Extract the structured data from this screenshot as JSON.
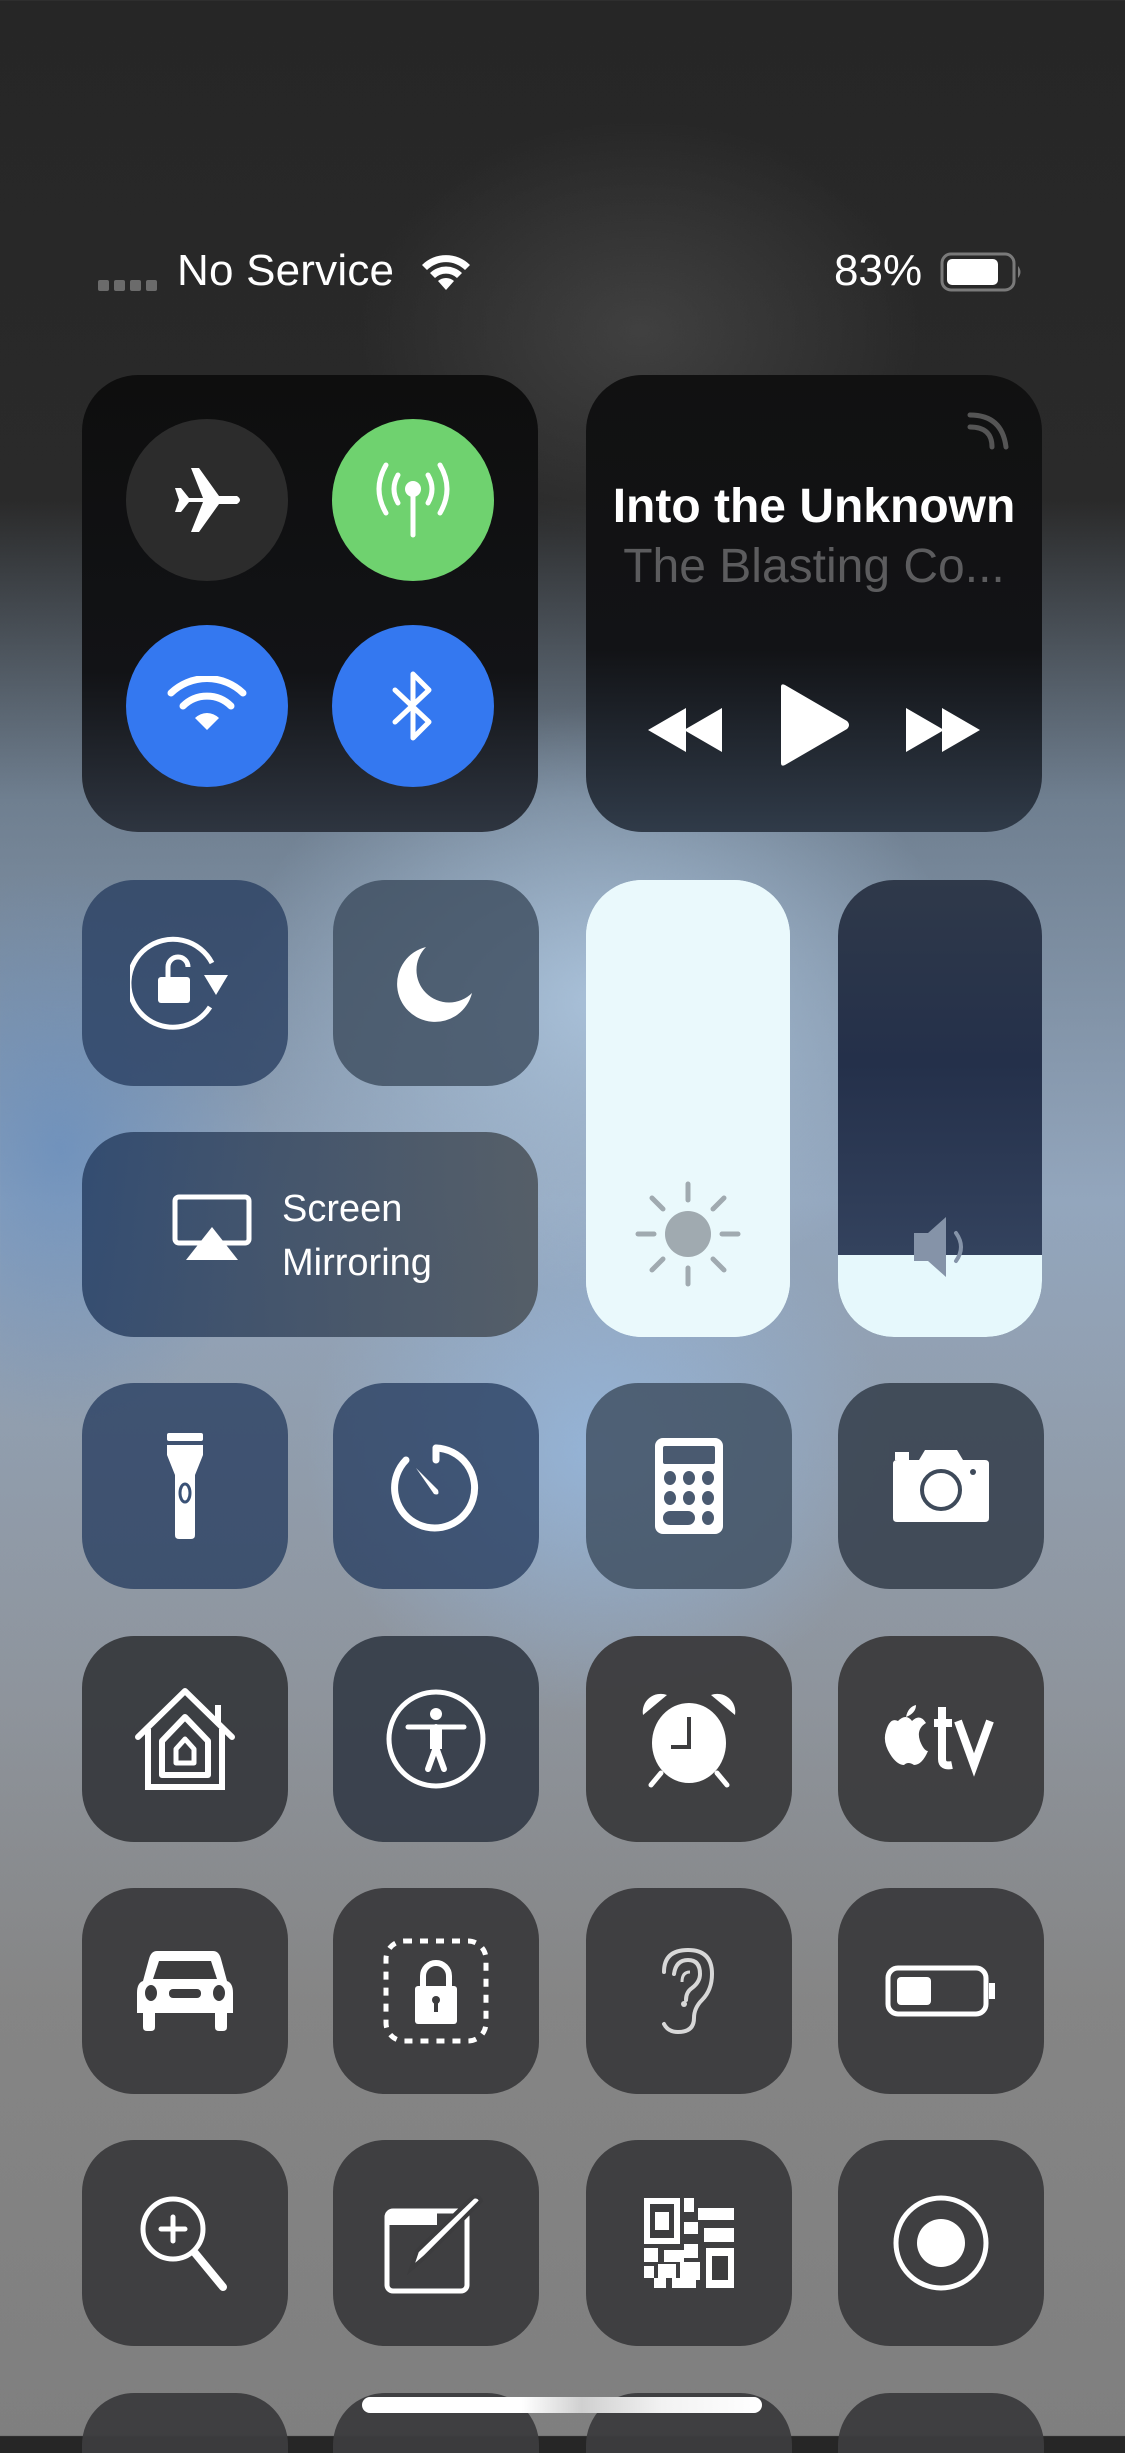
{
  "status_bar": {
    "carrier": "No Service",
    "battery_percent": "83%",
    "battery_level": 0.83,
    "signal_bars": 0,
    "wifi_connected": true
  },
  "connectivity": {
    "airplane_mode": {
      "label": "Airplane Mode",
      "on": false,
      "icon": "airplane-icon"
    },
    "cellular_data": {
      "label": "Cellular Data",
      "on": true,
      "icon": "antenna-icon",
      "color": "#6fd26f"
    },
    "wifi": {
      "label": "Wi-Fi",
      "on": true,
      "icon": "wifi-icon",
      "color": "#3478f0"
    },
    "bluetooth": {
      "label": "Bluetooth",
      "on": true,
      "icon": "bluetooth-icon",
      "color": "#3478f0"
    }
  },
  "now_playing": {
    "title": "Into the Unknown",
    "artist": "The Blasting Co...",
    "controls": [
      "rewind",
      "play",
      "fast-forward"
    ],
    "airplay_icon": "airplay-audio-icon"
  },
  "toggles": {
    "orientation_lock": {
      "label": "Orientation Lock",
      "icon": "rotation-lock-icon"
    },
    "do_not_disturb": {
      "label": "Do Not Disturb",
      "icon": "moon-icon"
    }
  },
  "screen_mirroring": {
    "line1": "Screen",
    "line2": "Mirroring",
    "icon": "airplay-screen-icon"
  },
  "sliders": {
    "brightness": {
      "label": "Brightness",
      "value": 1.0,
      "icon": "sun-icon"
    },
    "volume": {
      "label": "Volume",
      "value": 0.18,
      "icon": "speaker-icon"
    }
  },
  "tiles": [
    {
      "name": "flashlight",
      "label": "Flashlight",
      "icon": "flashlight-icon"
    },
    {
      "name": "timer",
      "label": "Timer",
      "icon": "timer-icon"
    },
    {
      "name": "calculator",
      "label": "Calculator",
      "icon": "calculator-icon"
    },
    {
      "name": "camera",
      "label": "Camera",
      "icon": "camera-icon"
    },
    {
      "name": "home",
      "label": "Home",
      "icon": "home-icon"
    },
    {
      "name": "accessibility",
      "label": "Accessibility Shortcuts",
      "icon": "accessibility-icon"
    },
    {
      "name": "alarm",
      "label": "Alarm",
      "icon": "alarm-clock-icon"
    },
    {
      "name": "apple-tv-remote",
      "label": "Apple TV Remote",
      "icon": "apple-tv-icon",
      "text": "tv"
    },
    {
      "name": "do-not-disturb-while-driving",
      "label": "Do Not Disturb While Driving",
      "icon": "car-icon"
    },
    {
      "name": "guided-access",
      "label": "Guided Access",
      "icon": "guided-access-lock-icon"
    },
    {
      "name": "hearing",
      "label": "Hearing",
      "icon": "ear-icon"
    },
    {
      "name": "low-power-mode",
      "label": "Low Power Mode",
      "icon": "battery-icon"
    },
    {
      "name": "magnifier",
      "label": "Magnifier",
      "icon": "magnifier-icon"
    },
    {
      "name": "notes",
      "label": "Notes",
      "icon": "notes-icon"
    },
    {
      "name": "scan-qr-code",
      "label": "Scan QR Code",
      "icon": "qr-code-icon"
    },
    {
      "name": "screen-recording",
      "label": "Screen Recording",
      "icon": "record-icon"
    }
  ],
  "colors": {
    "green": "#6fd26f",
    "blue": "#3478f0",
    "artist_gray": "#5c5c5e"
  }
}
